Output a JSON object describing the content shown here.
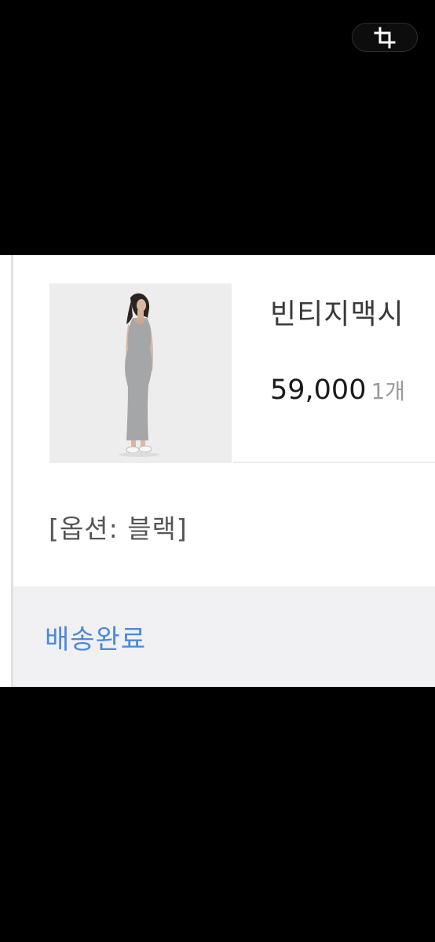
{
  "overlay": {
    "crop_icon": "crop-icon"
  },
  "order_item": {
    "product_name": "빈티지맥시",
    "price": "59,000",
    "quantity": "1개",
    "option": "[옵션: 블랙]",
    "thumbnail": "product-thumbnail"
  },
  "status": {
    "label": "배송완료",
    "color": "#4a8ad8"
  }
}
